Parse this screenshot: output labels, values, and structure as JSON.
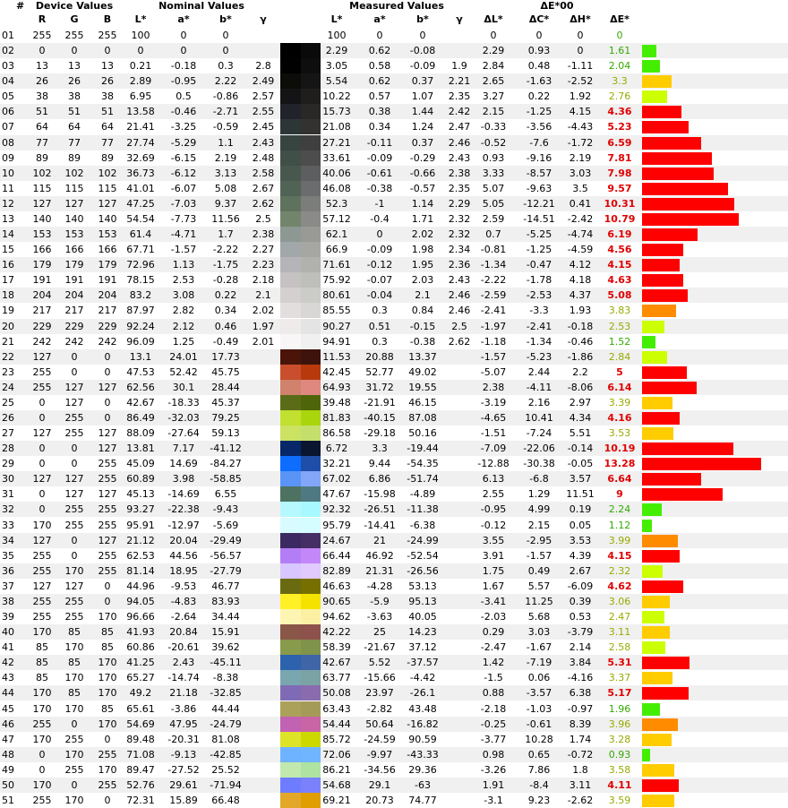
{
  "groups": {
    "index": "#",
    "device": "Device Values",
    "nominal": "Nominal Values",
    "measured": "Measured Values",
    "de00": "ΔE*00"
  },
  "columns": {
    "r": "R",
    "g": "G",
    "b": "B",
    "nL": "L*",
    "na": "a*",
    "nb": "b*",
    "ng": "γ",
    "mL": "L*",
    "ma": "a*",
    "mb": "b*",
    "mg": "γ",
    "dL": "ΔL*",
    "dC": "ΔC*",
    "dH": "ΔH*",
    "dE": "ΔE*"
  },
  "colors": {
    "stripe": "#f0f0f0",
    "de_good": "#44ee00",
    "de_ok": "#ccff00",
    "de_warn": "#ffcc00",
    "de_orange": "#ff8c00",
    "de_bad": "#ff0000",
    "de_bad_text": "#e00000"
  },
  "rows": [
    {
      "n": "01",
      "r": "255",
      "g": "255",
      "b": "255",
      "nL": "100",
      "na": "0",
      "nb": "0",
      "ng": "",
      "mL": "100",
      "ma": "0",
      "mb": "0",
      "mg": "",
      "dL": "0",
      "dC": "0",
      "dH": "0",
      "dE": "0",
      "nc": "#ffffff",
      "mc": "#ffffff"
    },
    {
      "n": "02",
      "r": "0",
      "g": "0",
      "b": "0",
      "nL": "0",
      "na": "0",
      "nb": "0",
      "ng": "",
      "mL": "2.29",
      "ma": "0.62",
      "mb": "-0.08",
      "mg": "",
      "dL": "2.29",
      "dC": "0.93",
      "dH": "0",
      "dE": "1.61",
      "nc": "#000000",
      "mc": "#0b0a0a"
    },
    {
      "n": "03",
      "r": "13",
      "g": "13",
      "b": "13",
      "nL": "0.21",
      "na": "-0.18",
      "nb": "0.3",
      "ng": "2.8",
      "mL": "3.05",
      "ma": "0.58",
      "mb": "-0.09",
      "mg": "1.9",
      "dL": "2.84",
      "dC": "0.48",
      "dH": "-1.11",
      "dE": "2.04",
      "nc": "#010101",
      "mc": "#0f0e0e"
    },
    {
      "n": "04",
      "r": "26",
      "g": "26",
      "b": "26",
      "nL": "2.89",
      "na": "-0.95",
      "nb": "2.22",
      "ng": "2.49",
      "mL": "5.54",
      "ma": "0.62",
      "mb": "0.37",
      "mg": "2.21",
      "dL": "2.65",
      "dC": "-1.63",
      "dH": "-2.52",
      "dE": "3.3",
      "nc": "#0c0d09",
      "mc": "#161515"
    },
    {
      "n": "05",
      "r": "38",
      "g": "38",
      "b": "38",
      "nL": "6.95",
      "na": "0.5",
      "nb": "-0.86",
      "ng": "2.57",
      "mL": "10.22",
      "ma": "0.57",
      "mb": "1.07",
      "mg": "2.35",
      "dL": "3.27",
      "dC": "0.22",
      "dH": "1.92",
      "dE": "2.76",
      "nc": "#141416",
      "mc": "#1f1e1d"
    },
    {
      "n": "06",
      "r": "51",
      "g": "51",
      "b": "51",
      "nL": "13.58",
      "na": "-0.46",
      "nb": "-2.71",
      "ng": "2.55",
      "mL": "15.73",
      "ma": "0.38",
      "mb": "1.44",
      "mg": "2.42",
      "dL": "2.15",
      "dC": "-1.25",
      "dH": "4.15",
      "dE": "4.36",
      "nc": "#21222a",
      "mc": "#292827"
    },
    {
      "n": "07",
      "r": "64",
      "g": "64",
      "b": "64",
      "nL": "21.41",
      "na": "-3.25",
      "nb": "-0.59",
      "ng": "2.45",
      "mL": "21.08",
      "ma": "0.34",
      "mb": "1.24",
      "mg": "2.47",
      "dL": "-0.33",
      "dC": "-3.56",
      "dH": "-4.43",
      "dE": "5.23",
      "nc": "#2d3636",
      "mc": "#333231"
    },
    {
      "n": "08",
      "r": "77",
      "g": "77",
      "b": "77",
      "nL": "27.74",
      "na": "-5.29",
      "nb": "1.1",
      "ng": "2.43",
      "mL": "27.21",
      "ma": "-0.11",
      "mb": "0.37",
      "mg": "2.46",
      "dL": "-0.52",
      "dC": "-7.6",
      "dH": "-1.72",
      "dE": "6.59",
      "nc": "#37443f",
      "mc": "#3f3f3f"
    },
    {
      "n": "09",
      "r": "89",
      "g": "89",
      "b": "89",
      "nL": "32.69",
      "na": "-6.15",
      "nb": "2.19",
      "ng": "2.48",
      "mL": "33.61",
      "ma": "-0.09",
      "mb": "-0.29",
      "mg": "2.43",
      "dL": "0.93",
      "dC": "-9.16",
      "dH": "2.19",
      "dE": "7.81",
      "nc": "#404f48",
      "mc": "#4d4d4e"
    },
    {
      "n": "10",
      "r": "102",
      "g": "102",
      "b": "102",
      "nL": "36.73",
      "na": "-6.12",
      "nb": "3.13",
      "ng": "2.58",
      "mL": "40.06",
      "ma": "-0.61",
      "mb": "-0.66",
      "mg": "2.38",
      "dL": "3.33",
      "dC": "-8.57",
      "dH": "3.03",
      "dE": "7.98",
      "nc": "#48584f",
      "mc": "#5d5e5f"
    },
    {
      "n": "11",
      "r": "115",
      "g": "115",
      "b": "115",
      "nL": "41.01",
      "na": "-6.07",
      "nb": "5.08",
      "ng": "2.67",
      "mL": "46.08",
      "ma": "-0.38",
      "mb": "-0.57",
      "mg": "2.35",
      "dL": "5.07",
      "dC": "-9.63",
      "dH": "3.5",
      "dE": "9.57",
      "nc": "#516355",
      "mc": "#6b6c6d"
    },
    {
      "n": "12",
      "r": "127",
      "g": "127",
      "b": "127",
      "nL": "47.25",
      "na": "-7.03",
      "nb": "9.37",
      "ng": "2.62",
      "mL": "52.3",
      "ma": "-1",
      "mb": "1.14",
      "mg": "2.29",
      "dL": "5.05",
      "dC": "-12.21",
      "dH": "0.41",
      "dE": "10.31",
      "nc": "#5f725d",
      "mc": "#7b7d7b"
    },
    {
      "n": "13",
      "r": "140",
      "g": "140",
      "b": "140",
      "nL": "54.54",
      "na": "-7.73",
      "nb": "11.56",
      "ng": "2.5",
      "mL": "57.12",
      "ma": "-0.4",
      "mb": "1.71",
      "mg": "2.32",
      "dL": "2.59",
      "dC": "-14.51",
      "dH": "-2.42",
      "dE": "10.79",
      "nc": "#72856c",
      "mc": "#8a8a88"
    },
    {
      "n": "14",
      "r": "153",
      "g": "153",
      "b": "153",
      "nL": "61.4",
      "na": "-4.71",
      "nb": "1.7",
      "ng": "2.38",
      "mL": "62.1",
      "ma": "0",
      "mb": "2.02",
      "mg": "2.32",
      "dL": "0.7",
      "dC": "-5.25",
      "dH": "-4.74",
      "dE": "6.19",
      "nc": "#8c9891",
      "mc": "#999996"
    },
    {
      "n": "15",
      "r": "166",
      "g": "166",
      "b": "166",
      "nL": "67.71",
      "na": "-1.57",
      "nb": "-2.22",
      "ng": "2.27",
      "mL": "66.9",
      "ma": "-0.09",
      "mb": "1.98",
      "mg": "2.34",
      "dL": "-0.81",
      "dC": "-1.25",
      "dH": "-4.59",
      "dE": "4.56",
      "nc": "#a2a7aa",
      "mc": "#a6a6a3"
    },
    {
      "n": "16",
      "r": "179",
      "g": "179",
      "b": "179",
      "nL": "72.96",
      "na": "1.13",
      "nb": "-1.75",
      "ng": "2.23",
      "mL": "71.61",
      "ma": "-0.12",
      "mb": "1.95",
      "mg": "2.36",
      "dL": "-1.34",
      "dC": "-0.47",
      "dH": "4.12",
      "dE": "4.15",
      "nc": "#b5b4b8",
      "mc": "#b1b1ae"
    },
    {
      "n": "17",
      "r": "191",
      "g": "191",
      "b": "191",
      "nL": "78.15",
      "na": "2.53",
      "nb": "-0.28",
      "ng": "2.18",
      "mL": "75.92",
      "ma": "-0.07",
      "mb": "2.03",
      "mg": "2.43",
      "dL": "-2.22",
      "dC": "-1.78",
      "dH": "4.18",
      "dE": "4.63",
      "nc": "#c6c2c3",
      "mc": "#bebebb"
    },
    {
      "n": "18",
      "r": "204",
      "g": "204",
      "b": "204",
      "nL": "83.2",
      "na": "3.08",
      "nb": "0.22",
      "ng": "2.1",
      "mL": "80.61",
      "ma": "-0.04",
      "mb": "2.1",
      "mg": "2.46",
      "dL": "-2.59",
      "dC": "-2.53",
      "dH": "4.37",
      "dE": "5.08",
      "nc": "#d5d0d0",
      "mc": "#cbcbc8"
    },
    {
      "n": "19",
      "r": "217",
      "g": "217",
      "b": "217",
      "nL": "87.97",
      "na": "2.82",
      "nb": "0.34",
      "ng": "2.02",
      "mL": "85.55",
      "ma": "0.3",
      "mb": "0.84",
      "mg": "2.46",
      "dL": "-2.41",
      "dC": "-3.3",
      "dH": "1.93",
      "dE": "3.83",
      "nc": "#e2dede",
      "mc": "#d8d7d6"
    },
    {
      "n": "20",
      "r": "229",
      "g": "229",
      "b": "229",
      "nL": "92.24",
      "na": "2.12",
      "nb": "0.46",
      "ng": "1.97",
      "mL": "90.27",
      "ma": "0.51",
      "mb": "-0.15",
      "mg": "2.5",
      "dL": "-1.97",
      "dC": "-2.41",
      "dH": "-0.18",
      "dE": "2.53",
      "nc": "#eeebea",
      "mc": "#e5e4e5"
    },
    {
      "n": "21",
      "r": "242",
      "g": "242",
      "b": "242",
      "nL": "96.09",
      "na": "1.25",
      "nb": "-0.49",
      "ng": "2.01",
      "mL": "94.91",
      "ma": "0.3",
      "mb": "-0.38",
      "mg": "2.62",
      "dL": "-1.18",
      "dC": "-1.34",
      "dH": "-0.46",
      "dE": "1.52",
      "nc": "#f8f6f7",
      "mc": "#f1f0f1"
    },
    {
      "n": "22",
      "r": "127",
      "g": "0",
      "b": "0",
      "nL": "13.1",
      "na": "24.01",
      "nb": "17.73",
      "ng": "",
      "mL": "11.53",
      "ma": "20.88",
      "mb": "13.37",
      "mg": "",
      "dL": "-1.57",
      "dC": "-5.23",
      "dH": "-1.86",
      "dE": "2.84",
      "nc": "#4a1409",
      "mc": "#3d130c"
    },
    {
      "n": "23",
      "r": "255",
      "g": "0",
      "b": "0",
      "nL": "47.53",
      "na": "52.42",
      "nb": "45.75",
      "ng": "",
      "mL": "42.45",
      "ma": "52.77",
      "mb": "49.02",
      "mg": "",
      "dL": "-5.07",
      "dC": "2.44",
      "dH": "2.2",
      "dE": "5",
      "nc": "#c84e2d",
      "mc": "#b83a0c"
    },
    {
      "n": "24",
      "r": "255",
      "g": "127",
      "b": "127",
      "nL": "62.56",
      "na": "30.1",
      "nb": "28.44",
      "ng": "",
      "mL": "64.93",
      "ma": "31.72",
      "mb": "19.55",
      "mg": "",
      "dL": "2.38",
      "dC": "-4.11",
      "dH": "-8.06",
      "dE": "6.14",
      "nc": "#d0826c",
      "mc": "#de8880"
    },
    {
      "n": "25",
      "r": "0",
      "g": "127",
      "b": "0",
      "nL": "42.67",
      "na": "-18.33",
      "nb": "45.37",
      "ng": "",
      "mL": "39.48",
      "ma": "-21.91",
      "mb": "46.15",
      "mg": "",
      "dL": "-3.19",
      "dC": "2.16",
      "dH": "2.97",
      "dE": "3.39",
      "nc": "#5a6c18",
      "mc": "#4e650a"
    },
    {
      "n": "26",
      "r": "0",
      "g": "255",
      "b": "0",
      "nL": "86.49",
      "na": "-32.03",
      "nb": "79.25",
      "ng": "",
      "mL": "81.83",
      "ma": "-40.15",
      "mb": "87.08",
      "mg": "",
      "dL": "-4.65",
      "dC": "10.41",
      "dH": "4.34",
      "dE": "4.16",
      "nc": "#c2e030",
      "mc": "#a9d50c"
    },
    {
      "n": "27",
      "r": "127",
      "g": "255",
      "b": "127",
      "nL": "88.09",
      "na": "-27.64",
      "nb": "59.13",
      "ng": "",
      "mL": "86.58",
      "ma": "-29.18",
      "mb": "50.16",
      "mg": "",
      "dL": "-1.51",
      "dC": "-7.24",
      "dH": "5.51",
      "dE": "3.53",
      "nc": "#cce262",
      "mc": "#c5df6c"
    },
    {
      "n": "28",
      "r": "0",
      "g": "0",
      "b": "127",
      "nL": "13.81",
      "na": "7.17",
      "nb": "-41.12",
      "ng": "",
      "mL": "6.72",
      "ma": "3.3",
      "mb": "-19.44",
      "mg": "",
      "dL": "-7.09",
      "dC": "-22.06",
      "dH": "-0.14",
      "dE": "10.19",
      "nc": "#072768",
      "mc": "#0a1630"
    },
    {
      "n": "29",
      "r": "0",
      "g": "0",
      "b": "255",
      "nL": "45.09",
      "na": "14.69",
      "nb": "-84.27",
      "ng": "",
      "mL": "32.21",
      "ma": "9.44",
      "mb": "-54.35",
      "mg": "",
      "dL": "-12.88",
      "dC": "-30.38",
      "dH": "-0.05",
      "dE": "13.28",
      "nc": "#0e6dff",
      "mc": "#1f4ea8"
    },
    {
      "n": "30",
      "r": "127",
      "g": "127",
      "b": "255",
      "nL": "60.89",
      "na": "3.98",
      "nb": "-58.85",
      "ng": "",
      "mL": "67.02",
      "ma": "6.86",
      "mb": "-51.74",
      "mg": "",
      "dL": "6.13",
      "dC": "-6.8",
      "dH": "3.57",
      "dE": "6.64",
      "nc": "#5a94f6",
      "mc": "#84a6f8"
    },
    {
      "n": "31",
      "r": "0",
      "g": "127",
      "b": "127",
      "nL": "45.13",
      "na": "-14.69",
      "nb": "6.55",
      "ng": "",
      "mL": "47.67",
      "ma": "-15.98",
      "mb": "-4.89",
      "mg": "",
      "dL": "2.55",
      "dC": "1.29",
      "dH": "11.51",
      "dE": "9",
      "nc": "#4d7262",
      "mc": "#4f7982"
    },
    {
      "n": "32",
      "r": "0",
      "g": "255",
      "b": "255",
      "nL": "93.27",
      "na": "-22.38",
      "nb": "-9.43",
      "ng": "",
      "mL": "92.32",
      "ma": "-26.51",
      "mb": "-11.38",
      "mg": "",
      "dL": "-0.95",
      "dC": "4.99",
      "dH": "0.19",
      "dE": "2.24",
      "nc": "#b6f8ff",
      "mc": "#a8f8ff"
    },
    {
      "n": "33",
      "r": "170",
      "g": "255",
      "b": "255",
      "nL": "95.91",
      "na": "-12.97",
      "nb": "-5.69",
      "ng": "",
      "mL": "95.79",
      "ma": "-14.41",
      "mb": "-6.38",
      "mg": "",
      "dL": "-0.12",
      "dC": "2.15",
      "dH": "0.05",
      "dE": "1.12",
      "nc": "#d8fbff",
      "mc": "#d5fcff"
    },
    {
      "n": "34",
      "r": "127",
      "g": "0",
      "b": "127",
      "nL": "21.12",
      "na": "20.04",
      "nb": "-29.49",
      "ng": "",
      "mL": "24.67",
      "ma": "21",
      "mb": "-24.99",
      "mg": "",
      "dL": "3.55",
      "dC": "-2.95",
      "dH": "3.53",
      "dE": "3.99",
      "nc": "#3b2961",
      "mc": "#452e63"
    },
    {
      "n": "35",
      "r": "255",
      "g": "0",
      "b": "255",
      "nL": "62.53",
      "na": "44.56",
      "nb": "-56.57",
      "ng": "",
      "mL": "66.44",
      "ma": "46.92",
      "mb": "-52.54",
      "mg": "",
      "dL": "3.91",
      "dC": "-1.57",
      "dH": "4.39",
      "dE": "4.15",
      "nc": "#b37ef5",
      "mc": "#c387f8"
    },
    {
      "n": "36",
      "r": "255",
      "g": "170",
      "b": "255",
      "nL": "81.14",
      "na": "18.95",
      "nb": "-27.79",
      "ng": "",
      "mL": "82.89",
      "ma": "21.31",
      "mb": "-26.56",
      "mg": "",
      "dL": "1.75",
      "dC": "0.49",
      "dH": "2.67",
      "dE": "2.32",
      "nc": "#d7c6ff",
      "mc": "#e0cafe"
    },
    {
      "n": "37",
      "r": "127",
      "g": "127",
      "b": "0",
      "nL": "44.96",
      "na": "-9.53",
      "nb": "46.77",
      "ng": "",
      "mL": "46.63",
      "ma": "-4.28",
      "mb": "53.13",
      "mg": "",
      "dL": "1.67",
      "dC": "5.57",
      "dH": "-6.09",
      "dE": "4.62",
      "nc": "#6a6b10",
      "mc": "#777000"
    },
    {
      "n": "38",
      "r": "255",
      "g": "255",
      "b": "0",
      "nL": "94.05",
      "na": "-4.83",
      "nb": "83.93",
      "ng": "",
      "mL": "90.65",
      "ma": "-5.9",
      "mb": "95.13",
      "mg": "",
      "dL": "-3.41",
      "dC": "11.25",
      "dH": "0.39",
      "dE": "3.06",
      "nc": "#fff126",
      "mc": "#f5e200"
    },
    {
      "n": "39",
      "r": "255",
      "g": "255",
      "b": "170",
      "nL": "96.66",
      "na": "-2.64",
      "nb": "34.44",
      "ng": "",
      "mL": "94.62",
      "ma": "-3.63",
      "mb": "40.05",
      "mg": "",
      "dL": "-2.03",
      "dC": "5.68",
      "dH": "0.53",
      "dE": "2.47",
      "nc": "#fff5b2",
      "mc": "#fbf0a3"
    },
    {
      "n": "40",
      "r": "170",
      "g": "85",
      "b": "85",
      "nL": "41.93",
      "na": "20.84",
      "nb": "15.91",
      "ng": "",
      "mL": "42.22",
      "ma": "25",
      "mb": "14.23",
      "mg": "",
      "dL": "0.29",
      "dC": "3.03",
      "dH": "-3.79",
      "dE": "3.11",
      "nc": "#8a5647",
      "mc": "#8d524b"
    },
    {
      "n": "41",
      "r": "85",
      "g": "170",
      "b": "85",
      "nL": "60.86",
      "na": "-20.61",
      "nb": "39.62",
      "ng": "",
      "mL": "58.39",
      "ma": "-21.67",
      "mb": "37.12",
      "mg": "",
      "dL": "-2.47",
      "dC": "-1.67",
      "dH": "2.14",
      "dE": "2.58",
      "nc": "#889a4b",
      "mc": "#80934b"
    },
    {
      "n": "42",
      "r": "85",
      "g": "85",
      "b": "170",
      "nL": "41.25",
      "na": "2.43",
      "nb": "-45.11",
      "ng": "",
      "mL": "42.67",
      "ma": "5.52",
      "mb": "-37.57",
      "mg": "",
      "dL": "1.42",
      "dC": "-7.19",
      "dH": "3.84",
      "dE": "5.31",
      "nc": "#2d62ad",
      "mc": "#3f65a6"
    },
    {
      "n": "43",
      "r": "85",
      "g": "170",
      "b": "170",
      "nL": "65.27",
      "na": "-14.74",
      "nb": "-8.38",
      "ng": "",
      "mL": "63.77",
      "ma": "-15.66",
      "mb": "-4.42",
      "mg": "",
      "dL": "-1.5",
      "dC": "0.06",
      "dH": "-4.16",
      "dE": "3.37",
      "nc": "#7aa6b0",
      "mc": "#7ba2a5"
    },
    {
      "n": "44",
      "r": "170",
      "g": "85",
      "b": "170",
      "nL": "49.2",
      "na": "21.18",
      "nb": "-32.85",
      "ng": "",
      "mL": "50.08",
      "ma": "23.97",
      "mb": "-26.1",
      "mg": "",
      "dL": "0.88",
      "dC": "-3.57",
      "dH": "6.38",
      "dE": "5.17",
      "nc": "#7f6bb5",
      "mc": "#8a6cae"
    },
    {
      "n": "45",
      "r": "170",
      "g": "170",
      "b": "85",
      "nL": "65.61",
      "na": "-3.86",
      "nb": "44.44",
      "ng": "",
      "mL": "63.43",
      "ma": "-2.82",
      "mb": "43.48",
      "mg": "",
      "dL": "-2.18",
      "dC": "-1.03",
      "dH": "-0.97",
      "dE": "1.96",
      "nc": "#aba15b",
      "mc": "#a59b58"
    },
    {
      "n": "46",
      "r": "255",
      "g": "0",
      "b": "170",
      "nL": "54.69",
      "na": "47.95",
      "nb": "-24.79",
      "ng": "",
      "mL": "54.44",
      "ma": "50.64",
      "mb": "-16.82",
      "mg": "",
      "dL": "-0.25",
      "dC": "-0.61",
      "dH": "8.39",
      "dE": "3.96",
      "nc": "#c262b3",
      "mc": "#c964a5"
    },
    {
      "n": "47",
      "r": "170",
      "g": "255",
      "b": "0",
      "nL": "89.48",
      "na": "-20.31",
      "nb": "81.08",
      "ng": "",
      "mL": "85.72",
      "ma": "-24.59",
      "mb": "90.59",
      "mg": "",
      "dL": "-3.77",
      "dC": "10.28",
      "dH": "1.74",
      "dE": "3.28",
      "nc": "#dde327",
      "mc": "#ccd800"
    },
    {
      "n": "48",
      "r": "0",
      "g": "170",
      "b": "255",
      "nL": "71.08",
      "na": "-9.13",
      "nb": "-42.85",
      "ng": "",
      "mL": "72.06",
      "ma": "-9.97",
      "mb": "-43.33",
      "mg": "",
      "dL": "0.98",
      "dC": "0.65",
      "dH": "-0.72",
      "dE": "0.93",
      "nc": "#6eb3ff",
      "mc": "#70b5ff"
    },
    {
      "n": "49",
      "r": "0",
      "g": "255",
      "b": "170",
      "nL": "89.47",
      "na": "-27.52",
      "nb": "25.52",
      "ng": "",
      "mL": "86.21",
      "ma": "-34.56",
      "mb": "29.36",
      "mg": "",
      "dL": "-3.26",
      "dC": "7.86",
      "dH": "1.8",
      "dE": "3.58",
      "nc": "#c1e9ae",
      "mc": "#aee3a2"
    },
    {
      "n": "50",
      "r": "170",
      "g": "0",
      "b": "255",
      "nL": "52.76",
      "na": "29.61",
      "nb": "-71.94",
      "ng": "",
      "mL": "54.68",
      "ma": "29.1",
      "mb": "-63",
      "mg": "",
      "dL": "1.91",
      "dC": "-8.4",
      "dH": "3.11",
      "dE": "4.11",
      "nc": "#6e7cff",
      "mc": "#7a81fb"
    },
    {
      "n": "51",
      "r": "255",
      "g": "170",
      "b": "0",
      "nL": "72.31",
      "na": "15.89",
      "nb": "66.48",
      "ng": "",
      "mL": "69.21",
      "ma": "20.73",
      "mb": "74.77",
      "mg": "",
      "dL": "-3.1",
      "dC": "9.23",
      "dH": "-2.62",
      "dE": "3.59",
      "nc": "#e3a829",
      "mc": "#e09e00"
    }
  ]
}
